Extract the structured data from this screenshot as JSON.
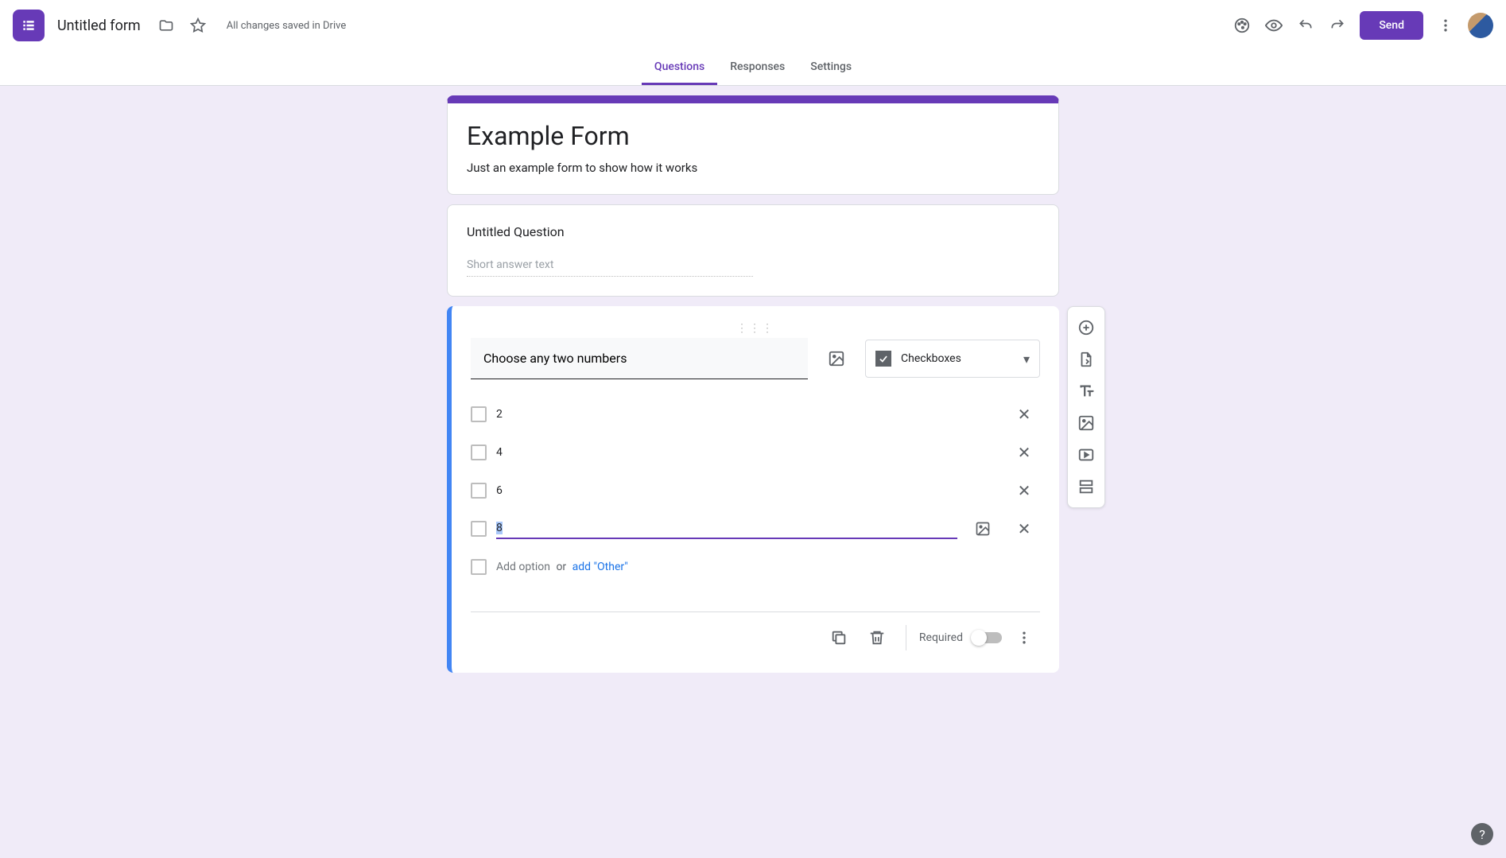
{
  "header": {
    "doc_title": "Untitled form",
    "save_status": "All changes saved in Drive",
    "send_label": "Send"
  },
  "tabs": {
    "questions": "Questions",
    "responses": "Responses",
    "settings": "Settings"
  },
  "form": {
    "title": "Example Form",
    "description": "Just an example form to show how it works"
  },
  "question1": {
    "title": "Untitled Question",
    "placeholder": "Short answer text"
  },
  "question2": {
    "title": "Choose any two numbers",
    "type_label": "Checkboxes",
    "options": {
      "o1": "2",
      "o2": "4",
      "o3": "6",
      "o4": "8"
    },
    "add_option": "Add option",
    "or": "or",
    "add_other": "add \"Other\"",
    "required_label": "Required"
  },
  "colors": {
    "primary": "#673ab7",
    "accent_blue": "#4285f4"
  }
}
